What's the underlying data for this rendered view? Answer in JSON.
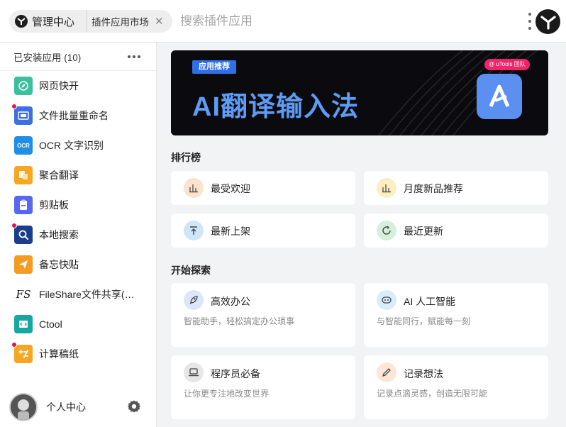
{
  "topbar": {
    "home_label": "管理中心",
    "tab_label": "插件应用市场",
    "search_placeholder": "搜索插件应用"
  },
  "sidebar": {
    "header_title": "已安装应用 (10)",
    "items": [
      {
        "label": "网页快开",
        "icon": "compass-icon",
        "color": "#3bbf9e",
        "dot": false
      },
      {
        "label": "文件批量重命名",
        "icon": "rename-file-icon",
        "color": "#3d6fe0",
        "dot": true
      },
      {
        "label": "OCR 文字识别",
        "icon": "ocr-icon",
        "color": "#1f8ee6",
        "dot": false
      },
      {
        "label": "聚合翻译",
        "icon": "translate-icon",
        "color": "#f5a623",
        "dot": false
      },
      {
        "label": "剪贴板",
        "icon": "clipboard-icon",
        "color": "#5468f0",
        "dot": false
      },
      {
        "label": "本地搜索",
        "icon": "search-icon",
        "color": "#1a3e8c",
        "dot": true
      },
      {
        "label": "备忘快贴",
        "icon": "memo-icon",
        "color": "#f59b23",
        "dot": false
      },
      {
        "label": "FileShare文件共享(局域网)",
        "icon": "fileshare-icon",
        "color": "#ffffff",
        "dot": false
      },
      {
        "label": "Ctool",
        "icon": "code-tool-icon",
        "color": "#17a7a0",
        "dot": false
      },
      {
        "label": "计算稿纸",
        "icon": "calculator-icon",
        "color": "#f5a623",
        "dot": true
      }
    ],
    "icon_texts": {
      "ocr": "OCR",
      "fileshare": "FS"
    },
    "profile_label": "个人中心"
  },
  "banner": {
    "tag": "应用推荐",
    "title": "AI翻译输入法",
    "badge": "@ uTools 团队"
  },
  "ranking": {
    "title": "排行榜",
    "cards": [
      {
        "label": "最受欢迎",
        "icon": "bar-chart-icon",
        "color": "#fde3cc"
      },
      {
        "label": "月度新品推荐",
        "icon": "bar-chart-icon",
        "color": "#fdeec0"
      },
      {
        "label": "最新上架",
        "icon": "upload-icon",
        "color": "#cfe6f9"
      },
      {
        "label": "最近更新",
        "icon": "refresh-icon",
        "color": "#d4f0dd"
      }
    ]
  },
  "explore": {
    "title": "开始探索",
    "cards": [
      {
        "label": "高效办公",
        "desc": "智能助手，轻松搞定办公琐事",
        "icon": "rocket-icon",
        "color": "#dbe6fb"
      },
      {
        "label": "AI 人工智能",
        "desc": "与智能同行，赋能每一刻",
        "icon": "robot-icon",
        "color": "#d8ecfa"
      },
      {
        "label": "程序员必备",
        "desc": "让你更专注地改变世界",
        "icon": "laptop-icon",
        "color": "#e6e6e6"
      },
      {
        "label": "记录想法",
        "desc": "记录点滴灵感，创造无限可能",
        "icon": "pencil-icon",
        "color": "#fde6d6"
      }
    ]
  }
}
